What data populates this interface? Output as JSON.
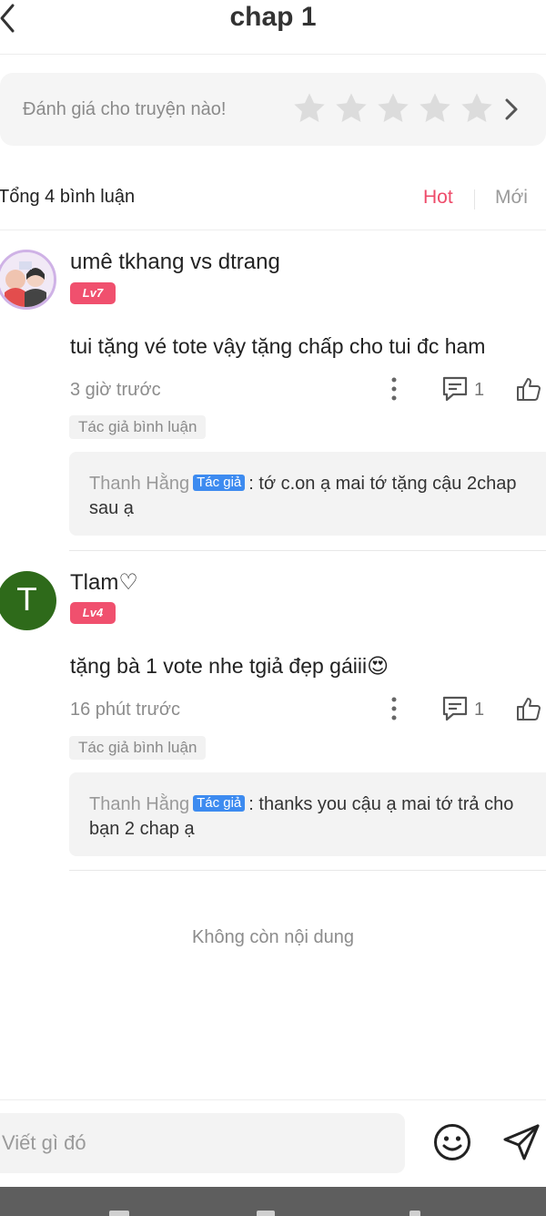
{
  "header": {
    "title": "chap 1",
    "back_icon": "chevron-left-icon"
  },
  "rating": {
    "prompt": "Đánh giá cho truyện nào!",
    "star_count": 5,
    "star_color": "#dcdcdc",
    "chevron_icon": "chevron-right-icon"
  },
  "comments_header": {
    "total": "Tổng 4 bình luận",
    "sort_hot": "Hot",
    "sort_new": "Mới",
    "active_color": "#ee4b6a"
  },
  "comments": [
    {
      "username": "umê tkhang vs dtrang",
      "level": "Lv7",
      "text": "tui tặng vé tote vậy tặng chấp cho tui đc ham",
      "time": "3 giờ trước",
      "reply_count": "1",
      "author_tag": "Tác giả bình luận",
      "reply": {
        "author": "Thanh Hằng",
        "badge": "Tác giả",
        "text": ": tớ c.on ạ mai tớ tặng cậu 2chap sau ạ"
      }
    },
    {
      "username": "Tlam♡",
      "avatar_letter": "T",
      "level": "Lv4",
      "text": "tặng bà 1 vote nhe tgiả đẹp gáiii😍",
      "time": "16 phút trước",
      "reply_count": "1",
      "author_tag": "Tác giả bình luận",
      "reply": {
        "author": "Thanh Hằng",
        "badge": "Tác giả",
        "text": ": thanks you cậu ạ mai tớ trả cho bạn 2 chap ạ"
      }
    }
  ],
  "end_text": "Không còn nội dung",
  "compose": {
    "placeholder": "Viết gì đó",
    "emoji_icon": "smile-icon",
    "send_icon": "send-icon"
  },
  "colors": {
    "level_badge": "#f0506e",
    "author_badge": "#3d8bf0",
    "avatar_green": "#2e6a1a"
  }
}
